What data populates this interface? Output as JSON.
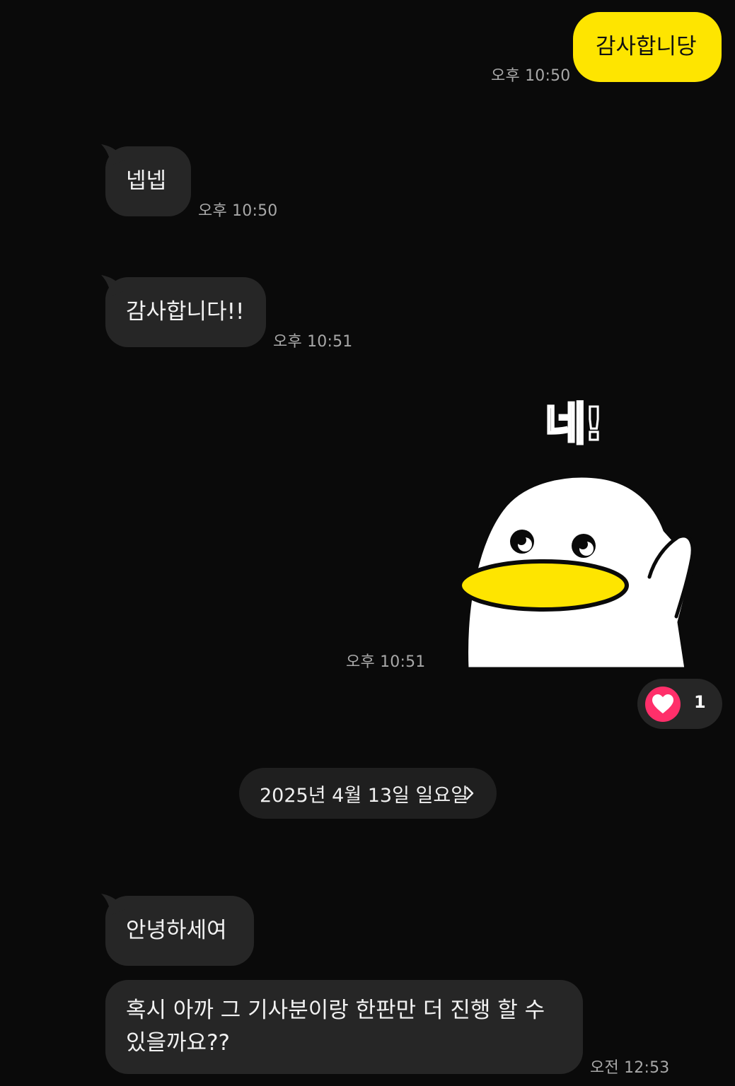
{
  "messages": [
    {
      "direction": "out",
      "text": "감사합니당",
      "time": "오후 10:50"
    },
    {
      "direction": "in",
      "text": "넵넵",
      "time": "오후 10:50"
    },
    {
      "direction": "in",
      "text": "감사합니다!!",
      "time": "오후 10:51"
    },
    {
      "direction": "out",
      "type": "sticker",
      "sticker_text": "네!",
      "sticker_icon": "white-duck-waving-sticker",
      "time": "오후 10:51",
      "reaction": {
        "icon": "heart-icon",
        "count": "1"
      }
    },
    {
      "direction": "in",
      "text": "안녕하세여"
    },
    {
      "direction": "in",
      "text": "혹시 아까 그 기사분이랑 한판만 더 진행 할 수 있을까요??",
      "time": "오전 12:53"
    }
  ],
  "date_divider": {
    "label": "2025년 4월 13일 일요일",
    "icon": "chevron-right-icon"
  },
  "colors": {
    "background": "#0a0a0a",
    "incoming_bubble": "#262626",
    "outgoing_bubble": "#fee500",
    "reaction_heart": "#ff2f6a",
    "timestamp": "#a8a8a8"
  }
}
